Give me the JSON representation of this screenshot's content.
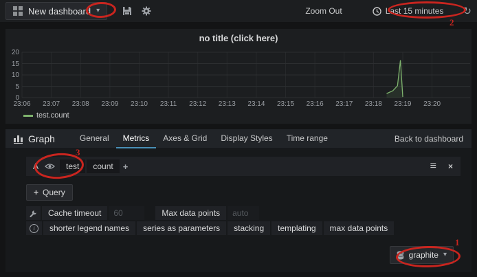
{
  "colors": {
    "accent_blue": "#4a90b8",
    "series_green": "#7eb26d",
    "annotation_red": "#c9251f"
  },
  "icons": {
    "caret_down": "▾",
    "plus": "+",
    "menu": "≡",
    "close": "×",
    "refresh": "↻"
  },
  "navbar": {
    "dashboard_title": "New dashboard",
    "zoom_out_label": "Zoom Out",
    "time_range_label": "Last 15 minutes"
  },
  "chart_data": {
    "type": "line",
    "title": "no title (click here)",
    "x_ticks": [
      "23:06",
      "23:07",
      "23:08",
      "23:09",
      "23:10",
      "23:11",
      "23:12",
      "23:13",
      "23:14",
      "23:15",
      "23:16",
      "23:17",
      "23:18",
      "23:19",
      "23:20"
    ],
    "x_tick_interval_minutes": 1,
    "xlim_minutes": [
      0,
      15.3
    ],
    "y_ticks": [
      0,
      5,
      10,
      15,
      20
    ],
    "ylim": [
      0,
      20
    ],
    "grid": true,
    "legend_position": "bottom-left",
    "series": [
      {
        "name": "test.count",
        "color": "#7eb26d",
        "points_minutes_value": [
          [
            12.45,
            1.8
          ],
          [
            12.66,
            3.0
          ],
          [
            12.82,
            5.2
          ],
          [
            12.92,
            16.5
          ],
          [
            13.0,
            0.3
          ]
        ]
      }
    ]
  },
  "editor": {
    "panel_type_label": "Graph",
    "tabs": [
      "General",
      "Metrics",
      "Axes & Grid",
      "Display Styles",
      "Time range"
    ],
    "active_tab": "Metrics",
    "back_link": "Back to dashboard",
    "query": {
      "row_label": "A",
      "segments": [
        "test",
        "count"
      ]
    },
    "add_query_label": "Query",
    "options": {
      "cache_timeout_label": "Cache timeout",
      "cache_timeout_placeholder": "60",
      "max_data_points_label": "Max data points",
      "max_data_points_placeholder": "auto",
      "toggles": [
        "shorter legend names",
        "series as parameters",
        "stacking",
        "templating",
        "max data points"
      ]
    },
    "datasource": {
      "label": "graphite"
    }
  },
  "annotations": {
    "color": "#c9251f",
    "items": [
      {
        "num": "1",
        "target": "datasource-picker"
      },
      {
        "num": "2",
        "target": "time-range-picker"
      },
      {
        "num": "3",
        "target": "metric-segments"
      }
    ]
  }
}
